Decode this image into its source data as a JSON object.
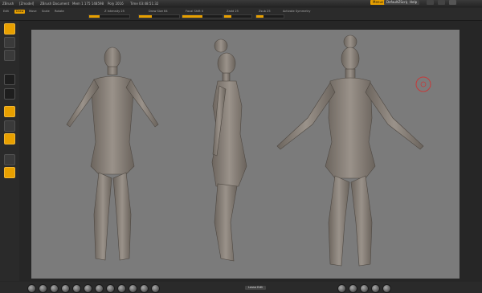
{
  "titlebar": {
    "app": "ZBrush",
    "doc": "[Zmodel]",
    "status": "ZBrush Document",
    "mem": "Mem 1 175 148598",
    "poly": "Poly 2016",
    "time": "Time 03:48:51:32"
  },
  "menu": {
    "items": [
      "Menus",
      "DefaultZScript",
      "Help"
    ],
    "active_index": 0
  },
  "toolbar": {
    "items": [
      "Edit",
      "Draw",
      "Move",
      "Scale",
      "Rotate"
    ],
    "params": [
      {
        "label": "Z Intensity 25",
        "value": 0.25
      },
      {
        "label": "Draw Size 64",
        "value": 0.32
      },
      {
        "label": "Focal Shift 0",
        "value": 0.5
      },
      {
        "label": "Zadd 25",
        "value": 0.25
      },
      {
        "label": "Zsub 25",
        "value": 0.25
      }
    ],
    "symmetry": "Activate Symmetry"
  },
  "viewport": {
    "background": "#7b7b7b",
    "model_color": "#8b837b",
    "views": [
      "front",
      "side",
      "back"
    ]
  },
  "bottombar": {
    "label": "Lasso Edit"
  },
  "colors": {
    "accent": "#e8a000",
    "cursor_ring": "#c63a3a"
  }
}
